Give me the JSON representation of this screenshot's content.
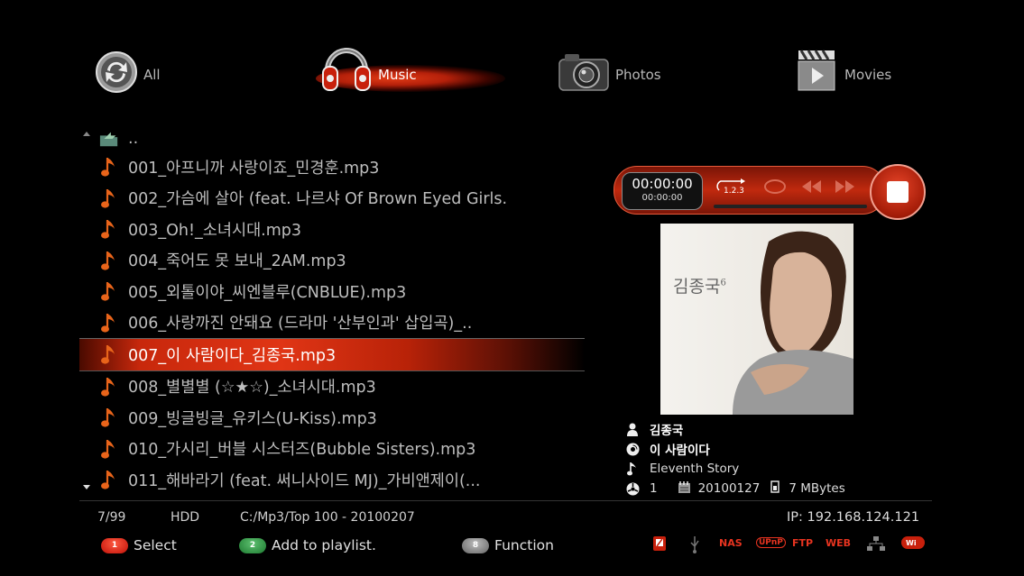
{
  "categories": [
    {
      "label": "All",
      "icon": "sync-icon"
    },
    {
      "label": "Music",
      "icon": "headphones-icon"
    },
    {
      "label": "Photos",
      "icon": "camera-icon"
    },
    {
      "label": "Movies",
      "icon": "clapperboard-icon"
    }
  ],
  "list": {
    "parent": "..",
    "items": [
      "001_아프니까 사랑이죠_민경훈.mp3",
      "002_가슴에 살아 (feat. 나르샤 Of Brown Eyed Girls.",
      "003_Oh!_소녀시대.mp3",
      "004_죽어도 못 보내_2AM.mp3",
      "005_외톨이야_씨엔블루(CNBLUE).mp3",
      "006_사랑까진 안돼요 (드라마 '산부인과' 삽입곡)_..",
      "007_이 사람이다_김종국.mp3",
      "008_별별별 (☆★☆)_소녀시대.mp3",
      "009_빙글빙글_유키스(U-Kiss).mp3",
      "010_가시리_버블 시스터즈(Bubble Sisters).mp3",
      "011_해바라기 (feat. 써니사이드 MJ)_가비앤제이(..."
    ],
    "selected_index": 6
  },
  "player": {
    "time": "00:00:00",
    "total": "00:00:00",
    "repeat_label": "1.2.3"
  },
  "album": {
    "art_title": "김종국",
    "art_number": "6"
  },
  "track": {
    "artist": "김종국",
    "title": "이 사람이다",
    "album": "Eleventh Story",
    "track_no": "1",
    "date": "20100127",
    "size": "7 MBytes"
  },
  "status": {
    "position": "7/99",
    "source": "HDD",
    "path": "C:/Mp3/Top 100 - 20100207",
    "ip": "IP: 192.168.124.121"
  },
  "hints": [
    {
      "key": "1",
      "label": "Select",
      "color": "#d4200c"
    },
    {
      "key": "2",
      "label": "Add to playlist.",
      "color": "#2a8a3a"
    },
    {
      "key": "8",
      "label": "Function",
      "color": "#888888"
    }
  ],
  "network": [
    "NAS",
    "UPnP",
    "FTP",
    "WEB"
  ]
}
